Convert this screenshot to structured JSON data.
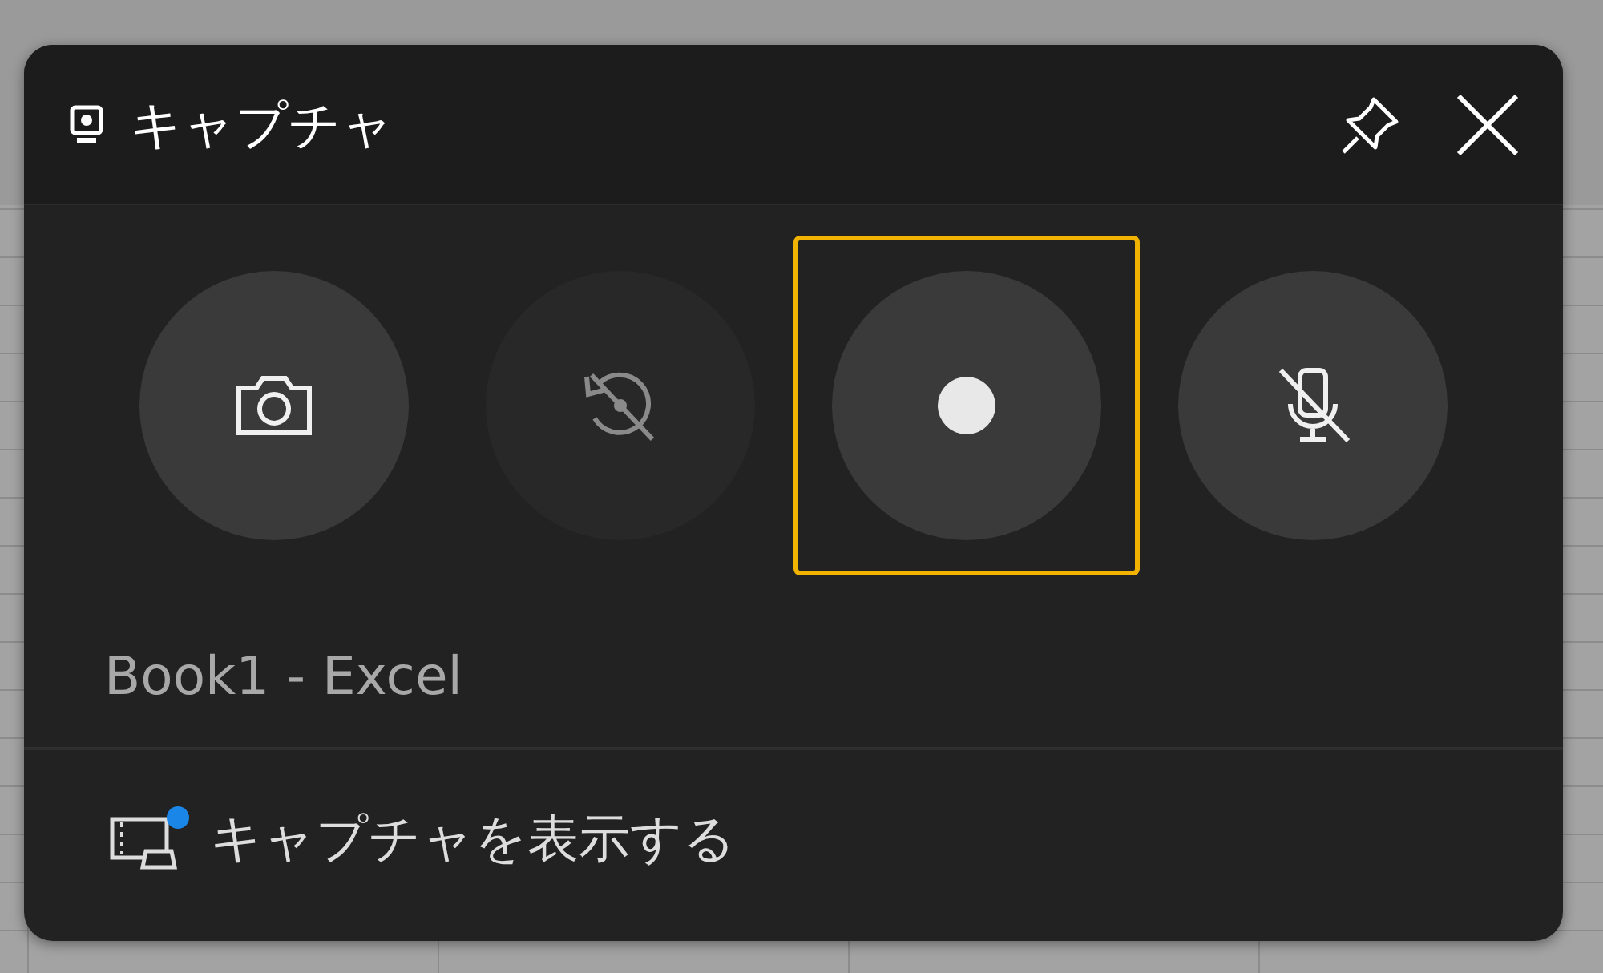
{
  "widget": {
    "title": "キャプチャ",
    "pinned": false
  },
  "buttons": [
    {
      "kind": "screenshot",
      "disabled": false,
      "focused": false
    },
    {
      "kind": "record-last",
      "disabled": true,
      "focused": false
    },
    {
      "kind": "record",
      "disabled": false,
      "focused": true
    },
    {
      "kind": "microphone",
      "disabled": false,
      "focused": false,
      "muted": true
    }
  ],
  "app_name": "Book1 - Excel",
  "footer": {
    "label": "キャプチャを表示する",
    "notification": true
  }
}
